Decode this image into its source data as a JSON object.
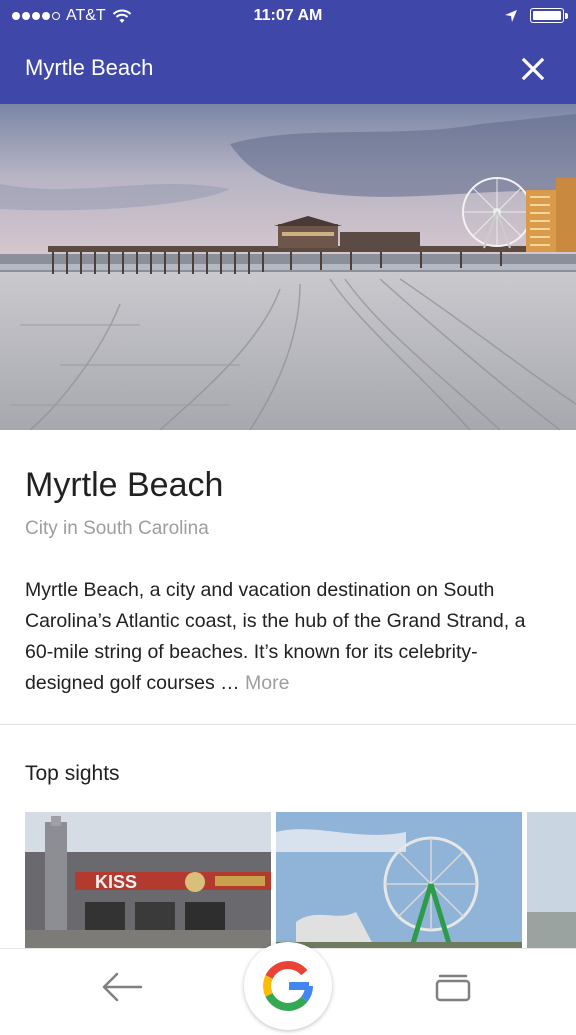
{
  "status": {
    "carrier": "AT&T",
    "time": "11:07 AM"
  },
  "header": {
    "title": "Myrtle Beach"
  },
  "place": {
    "name": "Myrtle Beach",
    "type": "City in South Carolina",
    "description": "Myrtle Beach, a city and vacation destination on South Carolina’s Atlantic coast, is the hub of the Grand Strand, a 60-mile string of beaches. It’s known for its celebrity-designed golf courses … ",
    "more_label": "More"
  },
  "top_sights": {
    "title": "Top sights",
    "sign_text": "KISS"
  },
  "colors": {
    "primary": "#3F48A8",
    "text": "#212121",
    "secondary_text": "#9E9E9E"
  },
  "icons": {
    "close": "close-icon",
    "back": "arrow-back-icon",
    "google": "google-g-icon",
    "tabs": "tabs-icon",
    "wifi": "wifi-icon",
    "location": "location-arrow-icon",
    "battery": "battery-icon"
  }
}
